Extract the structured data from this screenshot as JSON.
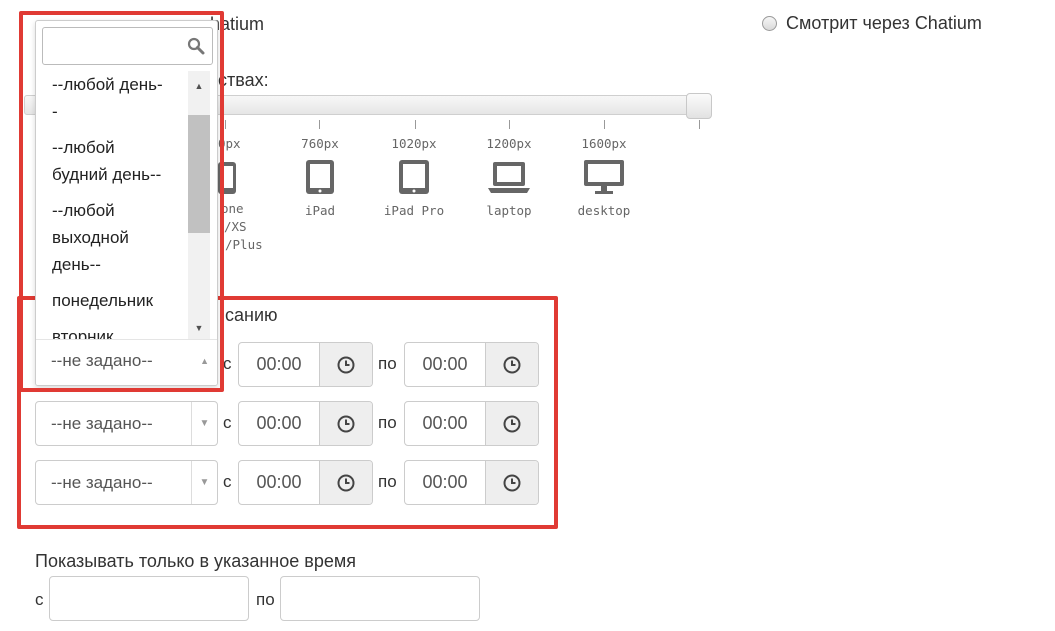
{
  "top": {
    "left_radio_label_fragment": "hatium",
    "right_radio_label": "Смотрит через Chatium"
  },
  "devices": {
    "heading_fragment": "ствах:",
    "items": [
      {
        "px": "0px",
        "name": "one",
        "name2": "/XS",
        "name3": "/Plus",
        "icon": "phone-icon"
      },
      {
        "px": "760px",
        "name": "iPad",
        "icon": "tablet-icon"
      },
      {
        "px": "1020px",
        "name": "iPad Pro",
        "icon": "tablet-pro-icon"
      },
      {
        "px": "1200px",
        "name": "laptop",
        "icon": "laptop-icon"
      },
      {
        "px": "1600px",
        "name": "desktop",
        "icon": "desktop-icon"
      }
    ]
  },
  "schedule": {
    "heading_fragment": "санию",
    "from_label": "с",
    "to_label": "по",
    "rows": [
      {
        "day": "--не задано--",
        "from": "00:00",
        "to": "00:00"
      },
      {
        "day": "--не задано--",
        "from": "00:00",
        "to": "00:00"
      },
      {
        "day": "--не задано--",
        "from": "00:00",
        "to": "00:00"
      }
    ]
  },
  "dropdown": {
    "search_value": "",
    "options": [
      "--любой день--",
      "--любой будний день--",
      "--любой выходной день--",
      "понедельник",
      "вторник"
    ],
    "selected": "--не задано--"
  },
  "time_window": {
    "heading": "Показывать только в указанное время",
    "from_label": "с",
    "to_label": "по",
    "from_value": "",
    "to_value": ""
  }
}
